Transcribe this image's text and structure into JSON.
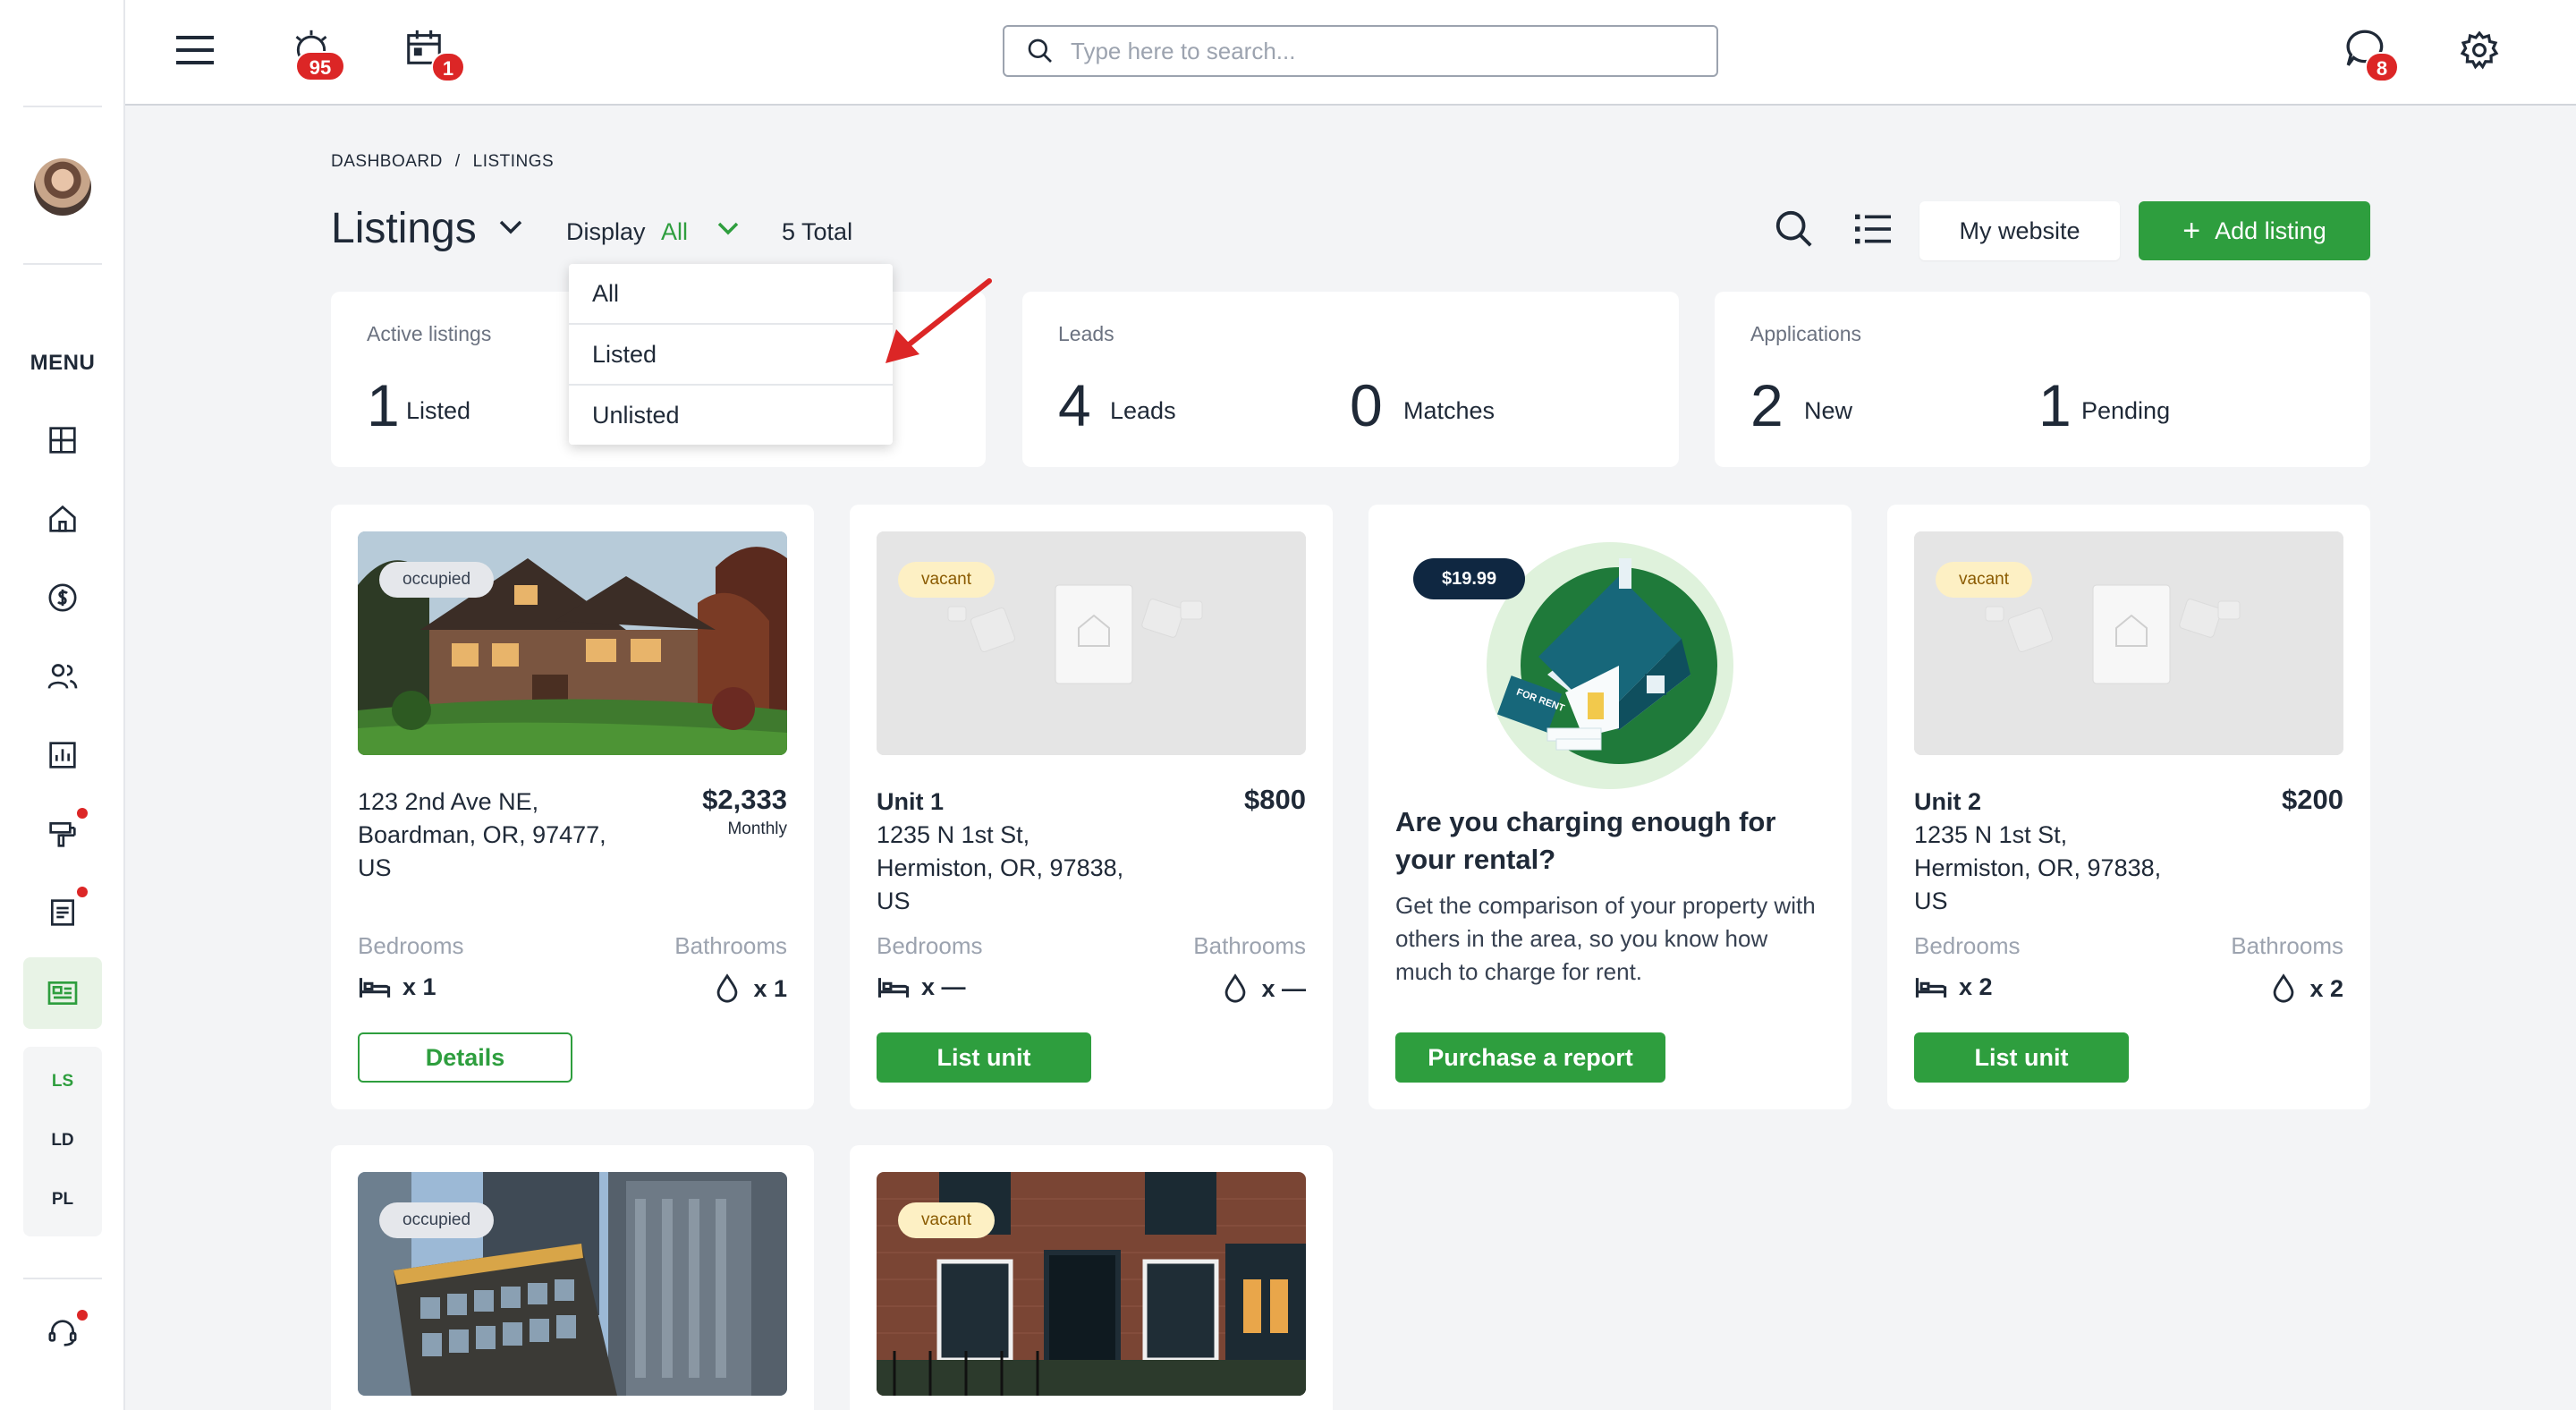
{
  "topbar": {
    "alerts_badge": "95",
    "calendar_badge": "1",
    "messages_badge": "8",
    "search_placeholder": "Type here to search..."
  },
  "sidebar": {
    "menu_label": "MENU",
    "sub_items": [
      "LS",
      "LD",
      "PL"
    ]
  },
  "breadcrumb": [
    "DASHBOARD",
    "/",
    "LISTINGS"
  ],
  "header": {
    "title": "Listings",
    "display_label": "Display",
    "display_value": "All",
    "total": "5 Total",
    "my_website": "My website",
    "add_listing": "Add listing"
  },
  "dropdown": {
    "options": [
      "All",
      "Listed",
      "Unlisted"
    ]
  },
  "stats": {
    "active": {
      "title": "Active listings",
      "num": "1",
      "label": "Listed"
    },
    "leads": {
      "title": "Leads",
      "num1": "4",
      "label1": "Leads",
      "num2": "0",
      "label2": "Matches"
    },
    "applications": {
      "title": "Applications",
      "num1": "2",
      "label1": "New",
      "num2": "1",
      "label2": "Pending"
    }
  },
  "listings": [
    {
      "status": "occupied",
      "line1": "123 2nd Ave NE,",
      "line2": "Boardman, OR, 97477,",
      "line3": "US",
      "price": "$2,333",
      "period": "Monthly",
      "bedrooms_label": "Bedrooms",
      "bathrooms_label": "Bathrooms",
      "beds": "x 1",
      "baths": "x 1",
      "button": "Details"
    },
    {
      "status": "vacant",
      "name": "Unit 1",
      "line1": "1235 N 1st St,",
      "line2": "Hermiston, OR, 97838,",
      "line3": "US",
      "price": "$800",
      "bedrooms_label": "Bedrooms",
      "bathrooms_label": "Bathrooms",
      "beds": "x —",
      "baths": "x —",
      "button": "List unit"
    },
    {
      "status": "vacant",
      "name": "Unit 2",
      "line1": "1235 N 1st St,",
      "line2": "Hermiston, OR, 97838,",
      "line3": "US",
      "price": "$200",
      "bedrooms_label": "Bedrooms",
      "bathrooms_label": "Bathrooms",
      "beds": "x 2",
      "baths": "x 2",
      "button": "List unit"
    },
    {
      "status": "occupied"
    },
    {
      "status": "vacant"
    }
  ],
  "promo": {
    "price": "$19.99",
    "sign_text": "FOR RENT",
    "title": "Are you charging enough for your rental?",
    "text": "Get the comparison of your property with others in the area, so you know how much to charge for rent.",
    "button": "Purchase a report"
  },
  "colors": {
    "accent_green": "#2e9e3e",
    "badge_red": "#dc2626",
    "vacant_pill": "#fdf0c4",
    "occupied_pill": "#e5e7eb",
    "promo_pill": "#0f2741"
  }
}
